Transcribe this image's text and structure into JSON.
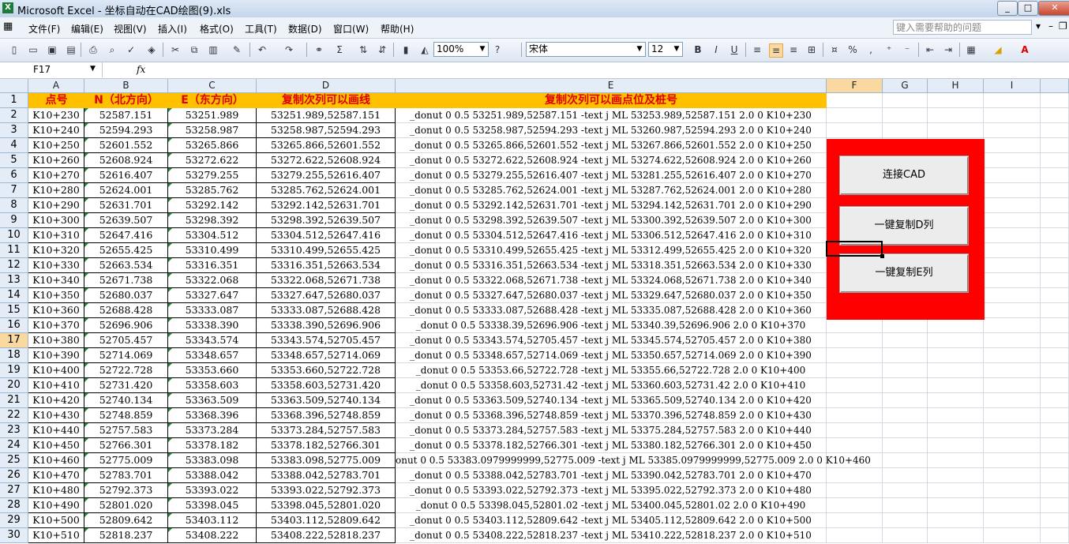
{
  "window": {
    "title": "Microsoft Excel - 坐标自动在CAD绘图(9).xls"
  },
  "menu": [
    "文件(F)",
    "编辑(E)",
    "视图(V)",
    "插入(I)",
    "格式(O)",
    "工具(T)",
    "数据(D)",
    "窗口(W)",
    "帮助(H)"
  ],
  "help_placeholder": "键入需要帮助的问题",
  "toolbar": {
    "zoom": "100%",
    "font": "宋体",
    "font_size": "12"
  },
  "formula": {
    "cell_ref": "F17",
    "fx": "fx",
    "value": ""
  },
  "columns": [
    "A",
    "B",
    "C",
    "D",
    "E",
    "F",
    "G",
    "H",
    "I"
  ],
  "header_row": {
    "A": "点号",
    "B": "N（北方向）",
    "C": "E（东方向）",
    "D": "复制次列可以画线",
    "E": "复制次列可以画点位及桩号"
  },
  "rows": [
    {
      "n": "2",
      "a": "K10+230",
      "b": "52587.151",
      "c": "53251.989",
      "d": "53251.989,52587.151",
      "e": "_donut 0 0.5 53251.989,52587.151  -text j ML 53253.989,52587.151 2.0 0 K10+230"
    },
    {
      "n": "3",
      "a": "K10+240",
      "b": "52594.293",
      "c": "53258.987",
      "d": "53258.987,52594.293",
      "e": "_donut 0 0.5 53258.987,52594.293  -text j ML 53260.987,52594.293 2.0 0 K10+240"
    },
    {
      "n": "4",
      "a": "K10+250",
      "b": "52601.552",
      "c": "53265.866",
      "d": "53265.866,52601.552",
      "e": "_donut 0 0.5 53265.866,52601.552  -text j ML 53267.866,52601.552 2.0 0 K10+250"
    },
    {
      "n": "5",
      "a": "K10+260",
      "b": "52608.924",
      "c": "53272.622",
      "d": "53272.622,52608.924",
      "e": "_donut 0 0.5 53272.622,52608.924  -text j ML 53274.622,52608.924 2.0 0 K10+260"
    },
    {
      "n": "6",
      "a": "K10+270",
      "b": "52616.407",
      "c": "53279.255",
      "d": "53279.255,52616.407",
      "e": "_donut 0 0.5 53279.255,52616.407  -text j ML 53281.255,52616.407 2.0 0 K10+270"
    },
    {
      "n": "7",
      "a": "K10+280",
      "b": "52624.001",
      "c": "53285.762",
      "d": "53285.762,52624.001",
      "e": "_donut 0 0.5 53285.762,52624.001  -text j ML 53287.762,52624.001 2.0 0 K10+280"
    },
    {
      "n": "8",
      "a": "K10+290",
      "b": "52631.701",
      "c": "53292.142",
      "d": "53292.142,52631.701",
      "e": "_donut 0 0.5 53292.142,52631.701  -text j ML 53294.142,52631.701 2.0 0 K10+290"
    },
    {
      "n": "9",
      "a": "K10+300",
      "b": "52639.507",
      "c": "53298.392",
      "d": "53298.392,52639.507",
      "e": "_donut 0 0.5 53298.392,52639.507  -text j ML 53300.392,52639.507 2.0 0 K10+300"
    },
    {
      "n": "10",
      "a": "K10+310",
      "b": "52647.416",
      "c": "53304.512",
      "d": "53304.512,52647.416",
      "e": "_donut 0 0.5 53304.512,52647.416  -text j ML 53306.512,52647.416 2.0 0 K10+310"
    },
    {
      "n": "11",
      "a": "K10+320",
      "b": "52655.425",
      "c": "53310.499",
      "d": "53310.499,52655.425",
      "e": "_donut 0 0.5 53310.499,52655.425  -text j ML 53312.499,52655.425 2.0 0 K10+320"
    },
    {
      "n": "12",
      "a": "K10+330",
      "b": "52663.534",
      "c": "53316.351",
      "d": "53316.351,52663.534",
      "e": "_donut 0 0.5 53316.351,52663.534  -text j ML 53318.351,52663.534 2.0 0 K10+330"
    },
    {
      "n": "13",
      "a": "K10+340",
      "b": "52671.738",
      "c": "53322.068",
      "d": "53322.068,52671.738",
      "e": "_donut 0 0.5 53322.068,52671.738  -text j ML 53324.068,52671.738 2.0 0 K10+340"
    },
    {
      "n": "14",
      "a": "K10+350",
      "b": "52680.037",
      "c": "53327.647",
      "d": "53327.647,52680.037",
      "e": "_donut 0 0.5 53327.647,52680.037  -text j ML 53329.647,52680.037 2.0 0 K10+350"
    },
    {
      "n": "15",
      "a": "K10+360",
      "b": "52688.428",
      "c": "53333.087",
      "d": "53333.087,52688.428",
      "e": "_donut 0 0.5 53333.087,52688.428  -text j ML 53335.087,52688.428 2.0 0 K10+360"
    },
    {
      "n": "16",
      "a": "K10+370",
      "b": "52696.906",
      "c": "53338.390",
      "d": "53338.390,52696.906",
      "e": "_donut 0 0.5 53338.39,52696.906  -text j ML 53340.39,52696.906 2.0 0 K10+370"
    },
    {
      "n": "17",
      "a": "K10+380",
      "b": "52705.457",
      "c": "53343.574",
      "d": "53343.574,52705.457",
      "e": "_donut 0 0.5 53343.574,52705.457  -text j ML 53345.574,52705.457 2.0 0 K10+380"
    },
    {
      "n": "18",
      "a": "K10+390",
      "b": "52714.069",
      "c": "53348.657",
      "d": "53348.657,52714.069",
      "e": "_donut 0 0.5 53348.657,52714.069  -text j ML 53350.657,52714.069 2.0 0 K10+390"
    },
    {
      "n": "19",
      "a": "K10+400",
      "b": "52722.728",
      "c": "53353.660",
      "d": "53353.660,52722.728",
      "e": "_donut 0 0.5 53353.66,52722.728  -text j ML 53355.66,52722.728 2.0 0 K10+400"
    },
    {
      "n": "20",
      "a": "K10+410",
      "b": "52731.420",
      "c": "53358.603",
      "d": "53358.603,52731.420",
      "e": "_donut 0 0.5 53358.603,52731.42  -text j ML 53360.603,52731.42 2.0 0 K10+410"
    },
    {
      "n": "21",
      "a": "K10+420",
      "b": "52740.134",
      "c": "53363.509",
      "d": "53363.509,52740.134",
      "e": "_donut 0 0.5 53363.509,52740.134  -text j ML 53365.509,52740.134 2.0 0 K10+420"
    },
    {
      "n": "22",
      "a": "K10+430",
      "b": "52748.859",
      "c": "53368.396",
      "d": "53368.396,52748.859",
      "e": "_donut 0 0.5 53368.396,52748.859  -text j ML 53370.396,52748.859 2.0 0 K10+430"
    },
    {
      "n": "23",
      "a": "K10+440",
      "b": "52757.583",
      "c": "53373.284",
      "d": "53373.284,52757.583",
      "e": "_donut 0 0.5 53373.284,52757.583  -text j ML 53375.284,52757.583 2.0 0 K10+440"
    },
    {
      "n": "24",
      "a": "K10+450",
      "b": "52766.301",
      "c": "53378.182",
      "d": "53378.182,52766.301",
      "e": "_donut 0 0.5 53378.182,52766.301  -text j ML 53380.182,52766.301 2.0 0 K10+450"
    },
    {
      "n": "25",
      "a": "K10+460",
      "b": "52775.009",
      "c": "53383.098",
      "d": "53383.098,52775.009",
      "e": "onut 0 0.5 53383.0979999999,52775.009  -text j ML 53385.0979999999,52775.009 2.0 0 K10+460"
    },
    {
      "n": "26",
      "a": "K10+470",
      "b": "52783.701",
      "c": "53388.042",
      "d": "53388.042,52783.701",
      "e": "_donut 0 0.5 53388.042,52783.701  -text j ML 53390.042,52783.701 2.0 0 K10+470"
    },
    {
      "n": "27",
      "a": "K10+480",
      "b": "52792.373",
      "c": "53393.022",
      "d": "53393.022,52792.373",
      "e": "_donut 0 0.5 53393.022,52792.373  -text j ML 53395.022,52792.373 2.0 0 K10+480"
    },
    {
      "n": "28",
      "a": "K10+490",
      "b": "52801.020",
      "c": "53398.045",
      "d": "53398.045,52801.020",
      "e": "_donut 0 0.5 53398.045,52801.02  -text j ML 53400.045,52801.02 2.0 0 K10+490"
    },
    {
      "n": "29",
      "a": "K10+500",
      "b": "52809.642",
      "c": "53403.112",
      "d": "53403.112,52809.642",
      "e": "_donut 0 0.5 53403.112,52809.642  -text j ML 53405.112,52809.642 2.0 0 K10+500"
    },
    {
      "n": "30",
      "a": "K10+510",
      "b": "52818.237",
      "c": "53408.222",
      "d": "53408.222,52818.237",
      "e": "_donut 0 0.5 53408.222,52818.237  -text j ML 53410.222,52818.237 2.0 0 K10+510"
    }
  ],
  "buttons": {
    "connect": "连接CAD",
    "copy_d": "一键复制D列",
    "copy_e": "一键复制E列"
  },
  "colors": {
    "header_fill": "#ffc000",
    "header_text": "#e00000",
    "panel": "#ff0000",
    "selection": "#f9d99f"
  }
}
